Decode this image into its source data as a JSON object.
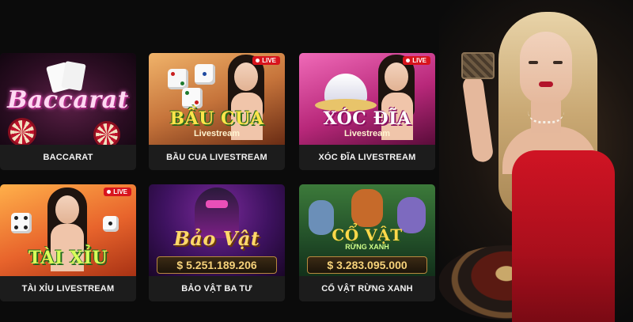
{
  "games": [
    {
      "id": "baccarat",
      "caption": "BACCARAT",
      "thumb_title": "Baccarat",
      "live": false
    },
    {
      "id": "bau-cua",
      "caption": "BẦU CUA LIVESTREAM",
      "thumb_title": "BẦU CUA",
      "thumb_sub": "Livestream",
      "live": true,
      "live_label": "LIVE"
    },
    {
      "id": "xoc-dia",
      "caption": "XÓC ĐĨA LIVESTREAM",
      "thumb_title": "XÓC ĐĨA",
      "thumb_sub": "Livestream",
      "live": true,
      "live_label": "LIVE"
    },
    {
      "id": "tai-xiu",
      "caption": "TÀI XỈU LIVESTREAM",
      "thumb_title": "TÀI XỈU",
      "live": true,
      "live_label": "LIVE"
    },
    {
      "id": "bao-vat-ba-tu",
      "caption": "BẢO VẬT BA TƯ",
      "thumb_title": "Bảo Vật",
      "jackpot_symbol": "$",
      "jackpot": "5.251.189.206",
      "live": false
    },
    {
      "id": "co-vat-rung-xanh",
      "caption": "CỔ VẬT RỪNG XANH",
      "thumb_title": "CỔ VẬT",
      "thumb_sub": "RỪNG XANH",
      "jackpot_symbol": "$",
      "jackpot": "3.283.095.000",
      "live": false
    }
  ],
  "colors": {
    "live_badge": "#d8141d",
    "tile_caption_bg": "#1c1c1c",
    "jackpot_text": "#f6d27a",
    "page_bg": "#0b0b0b"
  },
  "icons": [
    "live-dot-icon",
    "dice-icon",
    "playing-cards-icon",
    "roulette-wheel-icon"
  ]
}
